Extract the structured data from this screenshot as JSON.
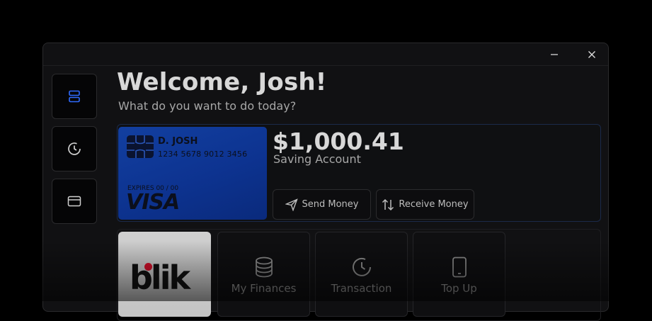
{
  "window": {
    "minimize_icon": "minimize-icon",
    "close_icon": "close-icon"
  },
  "sidebar": {
    "items": [
      {
        "icon": "accounts-icon",
        "active": true,
        "accent": "#2f6bff"
      },
      {
        "icon": "history-icon",
        "active": false
      },
      {
        "icon": "wallet-icon",
        "active": false
      }
    ]
  },
  "header": {
    "title": "Welcome, Josh!",
    "subtitle": "What do you want to do today?"
  },
  "card": {
    "holder": "D. JOSH",
    "number": "1234 5678 9012 3456",
    "expiry": "EXPIRES 00 / 00",
    "brand": "VISA",
    "color": "#123fa0"
  },
  "account": {
    "balance": "$1,000.41",
    "type": "Saving Account"
  },
  "actions": {
    "send_label": "Send Money",
    "receive_label": "Receive Money"
  },
  "tiles": [
    {
      "label": "blik",
      "icon": "blik-logo"
    },
    {
      "label": "My Finances",
      "icon": "coins-icon"
    },
    {
      "label": "Transaction",
      "icon": "history-icon"
    },
    {
      "label": "Top Up",
      "icon": "phone-icon"
    }
  ]
}
